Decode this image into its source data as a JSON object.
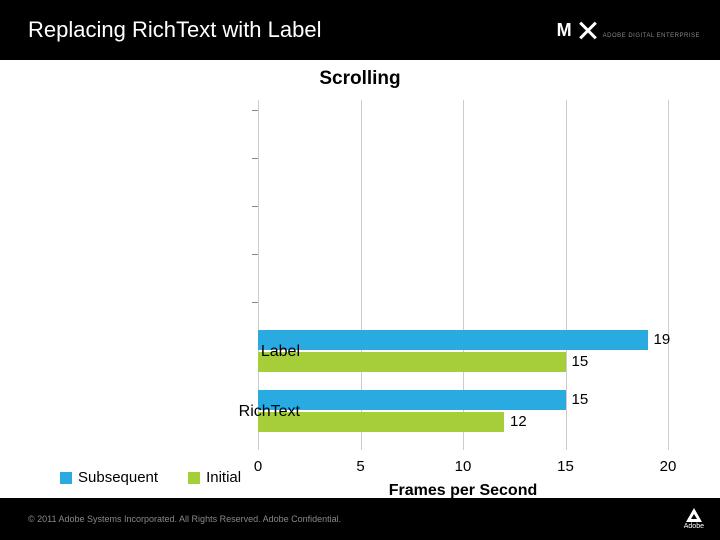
{
  "header": {
    "title": "Replacing RichText with Label",
    "logo_main": "M",
    "logo_sub": "ADOBE DIGITAL ENTERPRISE"
  },
  "footer": {
    "copyright": "© 2011 Adobe Systems Incorporated. All Rights Reserved. Adobe Confidential.",
    "brand": "Adobe"
  },
  "legend": {
    "subsequent": "Subsequent",
    "initial": "Initial"
  },
  "chart_data": {
    "type": "bar",
    "orientation": "horizontal",
    "title": "Scrolling",
    "xlabel": "Frames per Second",
    "ylabel": "",
    "xlim": [
      0,
      20
    ],
    "xticks": [
      0,
      5,
      10,
      15,
      20
    ],
    "categories": [
      "Label",
      "RichText"
    ],
    "series": [
      {
        "name": "Subsequent",
        "color": "#29abe2",
        "values": [
          19,
          15
        ]
      },
      {
        "name": "Initial",
        "color": "#a6ce39",
        "values": [
          15,
          12
        ]
      }
    ]
  }
}
